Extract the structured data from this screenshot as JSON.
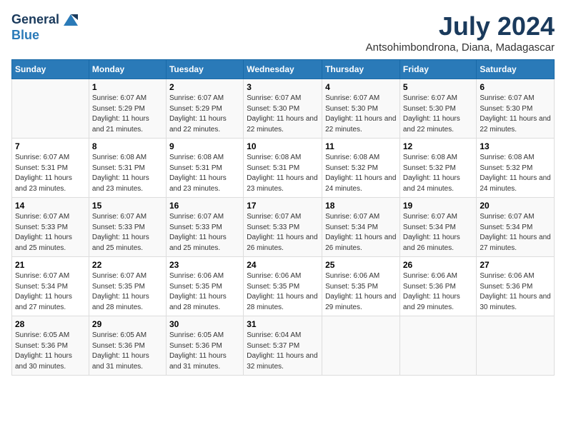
{
  "header": {
    "logo_line1": "General",
    "logo_line2": "Blue",
    "month_title": "July 2024",
    "location": "Antsohimbondrona, Diana, Madagascar"
  },
  "days_of_week": [
    "Sunday",
    "Monday",
    "Tuesday",
    "Wednesday",
    "Thursday",
    "Friday",
    "Saturday"
  ],
  "weeks": [
    [
      {
        "day": "",
        "sunrise": "",
        "sunset": "",
        "daylight": ""
      },
      {
        "day": "1",
        "sunrise": "Sunrise: 6:07 AM",
        "sunset": "Sunset: 5:29 PM",
        "daylight": "Daylight: 11 hours and 21 minutes."
      },
      {
        "day": "2",
        "sunrise": "Sunrise: 6:07 AM",
        "sunset": "Sunset: 5:29 PM",
        "daylight": "Daylight: 11 hours and 22 minutes."
      },
      {
        "day": "3",
        "sunrise": "Sunrise: 6:07 AM",
        "sunset": "Sunset: 5:30 PM",
        "daylight": "Daylight: 11 hours and 22 minutes."
      },
      {
        "day": "4",
        "sunrise": "Sunrise: 6:07 AM",
        "sunset": "Sunset: 5:30 PM",
        "daylight": "Daylight: 11 hours and 22 minutes."
      },
      {
        "day": "5",
        "sunrise": "Sunrise: 6:07 AM",
        "sunset": "Sunset: 5:30 PM",
        "daylight": "Daylight: 11 hours and 22 minutes."
      },
      {
        "day": "6",
        "sunrise": "Sunrise: 6:07 AM",
        "sunset": "Sunset: 5:30 PM",
        "daylight": "Daylight: 11 hours and 22 minutes."
      }
    ],
    [
      {
        "day": "7",
        "sunrise": "Sunrise: 6:07 AM",
        "sunset": "Sunset: 5:31 PM",
        "daylight": "Daylight: 11 hours and 23 minutes."
      },
      {
        "day": "8",
        "sunrise": "Sunrise: 6:08 AM",
        "sunset": "Sunset: 5:31 PM",
        "daylight": "Daylight: 11 hours and 23 minutes."
      },
      {
        "day": "9",
        "sunrise": "Sunrise: 6:08 AM",
        "sunset": "Sunset: 5:31 PM",
        "daylight": "Daylight: 11 hours and 23 minutes."
      },
      {
        "day": "10",
        "sunrise": "Sunrise: 6:08 AM",
        "sunset": "Sunset: 5:31 PM",
        "daylight": "Daylight: 11 hours and 23 minutes."
      },
      {
        "day": "11",
        "sunrise": "Sunrise: 6:08 AM",
        "sunset": "Sunset: 5:32 PM",
        "daylight": "Daylight: 11 hours and 24 minutes."
      },
      {
        "day": "12",
        "sunrise": "Sunrise: 6:08 AM",
        "sunset": "Sunset: 5:32 PM",
        "daylight": "Daylight: 11 hours and 24 minutes."
      },
      {
        "day": "13",
        "sunrise": "Sunrise: 6:08 AM",
        "sunset": "Sunset: 5:32 PM",
        "daylight": "Daylight: 11 hours and 24 minutes."
      }
    ],
    [
      {
        "day": "14",
        "sunrise": "Sunrise: 6:07 AM",
        "sunset": "Sunset: 5:33 PM",
        "daylight": "Daylight: 11 hours and 25 minutes."
      },
      {
        "day": "15",
        "sunrise": "Sunrise: 6:07 AM",
        "sunset": "Sunset: 5:33 PM",
        "daylight": "Daylight: 11 hours and 25 minutes."
      },
      {
        "day": "16",
        "sunrise": "Sunrise: 6:07 AM",
        "sunset": "Sunset: 5:33 PM",
        "daylight": "Daylight: 11 hours and 25 minutes."
      },
      {
        "day": "17",
        "sunrise": "Sunrise: 6:07 AM",
        "sunset": "Sunset: 5:33 PM",
        "daylight": "Daylight: 11 hours and 26 minutes."
      },
      {
        "day": "18",
        "sunrise": "Sunrise: 6:07 AM",
        "sunset": "Sunset: 5:34 PM",
        "daylight": "Daylight: 11 hours and 26 minutes."
      },
      {
        "day": "19",
        "sunrise": "Sunrise: 6:07 AM",
        "sunset": "Sunset: 5:34 PM",
        "daylight": "Daylight: 11 hours and 26 minutes."
      },
      {
        "day": "20",
        "sunrise": "Sunrise: 6:07 AM",
        "sunset": "Sunset: 5:34 PM",
        "daylight": "Daylight: 11 hours and 27 minutes."
      }
    ],
    [
      {
        "day": "21",
        "sunrise": "Sunrise: 6:07 AM",
        "sunset": "Sunset: 5:34 PM",
        "daylight": "Daylight: 11 hours and 27 minutes."
      },
      {
        "day": "22",
        "sunrise": "Sunrise: 6:07 AM",
        "sunset": "Sunset: 5:35 PM",
        "daylight": "Daylight: 11 hours and 28 minutes."
      },
      {
        "day": "23",
        "sunrise": "Sunrise: 6:06 AM",
        "sunset": "Sunset: 5:35 PM",
        "daylight": "Daylight: 11 hours and 28 minutes."
      },
      {
        "day": "24",
        "sunrise": "Sunrise: 6:06 AM",
        "sunset": "Sunset: 5:35 PM",
        "daylight": "Daylight: 11 hours and 28 minutes."
      },
      {
        "day": "25",
        "sunrise": "Sunrise: 6:06 AM",
        "sunset": "Sunset: 5:35 PM",
        "daylight": "Daylight: 11 hours and 29 minutes."
      },
      {
        "day": "26",
        "sunrise": "Sunrise: 6:06 AM",
        "sunset": "Sunset: 5:36 PM",
        "daylight": "Daylight: 11 hours and 29 minutes."
      },
      {
        "day": "27",
        "sunrise": "Sunrise: 6:06 AM",
        "sunset": "Sunset: 5:36 PM",
        "daylight": "Daylight: 11 hours and 30 minutes."
      }
    ],
    [
      {
        "day": "28",
        "sunrise": "Sunrise: 6:05 AM",
        "sunset": "Sunset: 5:36 PM",
        "daylight": "Daylight: 11 hours and 30 minutes."
      },
      {
        "day": "29",
        "sunrise": "Sunrise: 6:05 AM",
        "sunset": "Sunset: 5:36 PM",
        "daylight": "Daylight: 11 hours and 31 minutes."
      },
      {
        "day": "30",
        "sunrise": "Sunrise: 6:05 AM",
        "sunset": "Sunset: 5:36 PM",
        "daylight": "Daylight: 11 hours and 31 minutes."
      },
      {
        "day": "31",
        "sunrise": "Sunrise: 6:04 AM",
        "sunset": "Sunset: 5:37 PM",
        "daylight": "Daylight: 11 hours and 32 minutes."
      },
      {
        "day": "",
        "sunrise": "",
        "sunset": "",
        "daylight": ""
      },
      {
        "day": "",
        "sunrise": "",
        "sunset": "",
        "daylight": ""
      },
      {
        "day": "",
        "sunrise": "",
        "sunset": "",
        "daylight": ""
      }
    ]
  ]
}
